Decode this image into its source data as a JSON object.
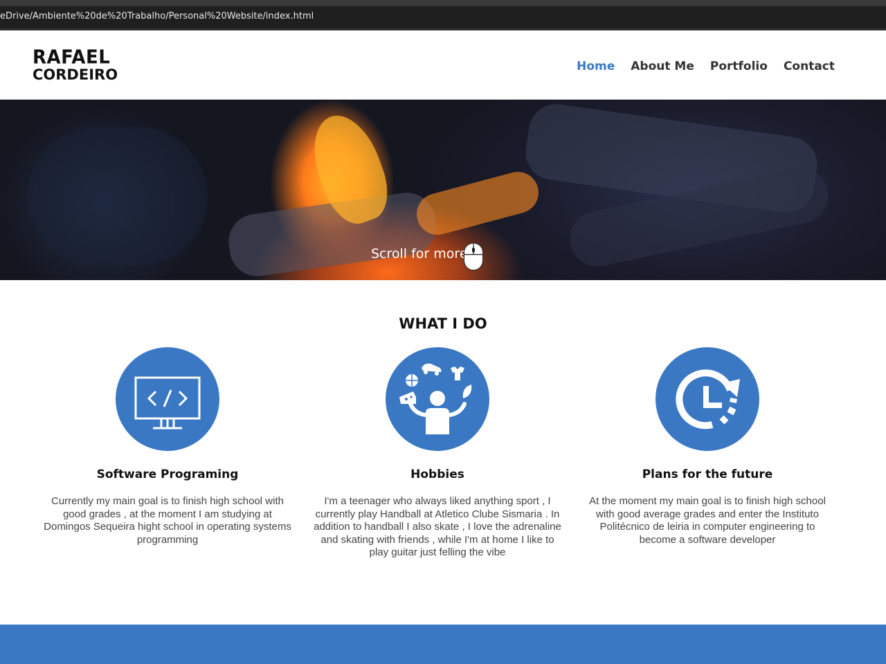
{
  "browser": {
    "url": "eDrive/Ambiente%20de%20Trabalho/Personal%20Website/index.html"
  },
  "header": {
    "logo_line1": "RAFAEL",
    "logo_line2": "CORDEIRO",
    "nav": [
      {
        "label": "Home",
        "active": true
      },
      {
        "label": "About Me",
        "active": false
      },
      {
        "label": "Portfolio",
        "active": false
      },
      {
        "label": "Contact",
        "active": false
      }
    ]
  },
  "hero": {
    "scroll_label": "Scroll for more",
    "icon": "mouse-icon"
  },
  "what_i_do": {
    "title": "WHAT I DO",
    "cards": [
      {
        "icon": "code-monitor-icon",
        "title": "Software Programing",
        "text": "Currently my main goal is to finish high school with good grades , at the moment I am studying at Domingos Sequeira hight school in operating systems programming"
      },
      {
        "icon": "juggling-hobbies-icon",
        "title": "Hobbies",
        "text": "I'm a teenager who always liked anything sport , I currently play Handball at Atletico Clube Sismaria . In addition to handball I also skate , I love the adrenaline and skating with friends , while I'm at home I like to play guitar just felling the vibe"
      },
      {
        "icon": "clock-future-icon",
        "title": "Plans for the future",
        "text": "At the moment my main goal is to finish high school with good average grades and enter the Instituto Politécnico de leiria in computer engineering to become a software developer"
      }
    ]
  },
  "colors": {
    "accent": "#3a78c4",
    "nav_text": "#333333",
    "heading": "#111111",
    "body_text": "#444444"
  }
}
